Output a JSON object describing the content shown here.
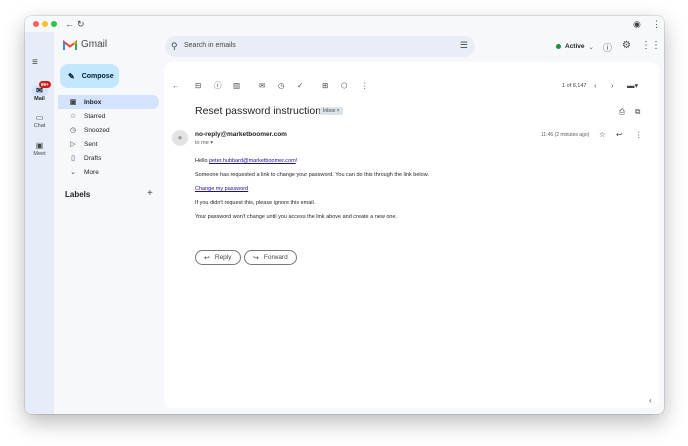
{
  "browser": {
    "back_icon": "arrow-left-icon",
    "reload_icon": "reload-icon"
  },
  "header": {
    "app_name": "Gmail",
    "search_placeholder": "Search in emails",
    "status_label": "Active",
    "status_color": "#1e8e3e"
  },
  "rail": {
    "items": [
      {
        "label": "Mail",
        "badge": "99+"
      },
      {
        "label": "Chat"
      },
      {
        "label": "Meet"
      }
    ]
  },
  "sidebar": {
    "compose_label": "Compose",
    "items": [
      {
        "label": "Inbox",
        "icon": "inbox-icon"
      },
      {
        "label": "Starred",
        "icon": "star-icon"
      },
      {
        "label": "Snoozed",
        "icon": "clock-icon"
      },
      {
        "label": "Sent",
        "icon": "send-icon"
      },
      {
        "label": "Drafts",
        "icon": "draft-icon"
      },
      {
        "label": "More",
        "icon": "chevron-down-icon"
      }
    ],
    "labels_title": "Labels"
  },
  "toolbar": {
    "counter": "1 of 8,147"
  },
  "email": {
    "subject": "Reset password instructions",
    "folder_chip": "Inbox ×",
    "sender": "no-reply@marketboomer.com",
    "recipient": "to me ▾",
    "time": "11:46 (2 minutes ago)",
    "greeting_prefix": "Hello ",
    "greeting_email": "peter.hubbard@marketboomer.com",
    "greeting_suffix": "!",
    "line1": "Someone has requested a link to change your password. You can do this through the link below.",
    "link_text": "Change my password",
    "line2": "If you didn't request this, please ignore this email.",
    "line3": "Your password won't change until you access the link above and create a new one."
  },
  "actions": {
    "reply_label": "Reply",
    "forward_label": "Forward"
  },
  "colors": {
    "accent": "#c2e7ff",
    "selected": "#d3e3fd",
    "background": "#f6f8fc"
  }
}
